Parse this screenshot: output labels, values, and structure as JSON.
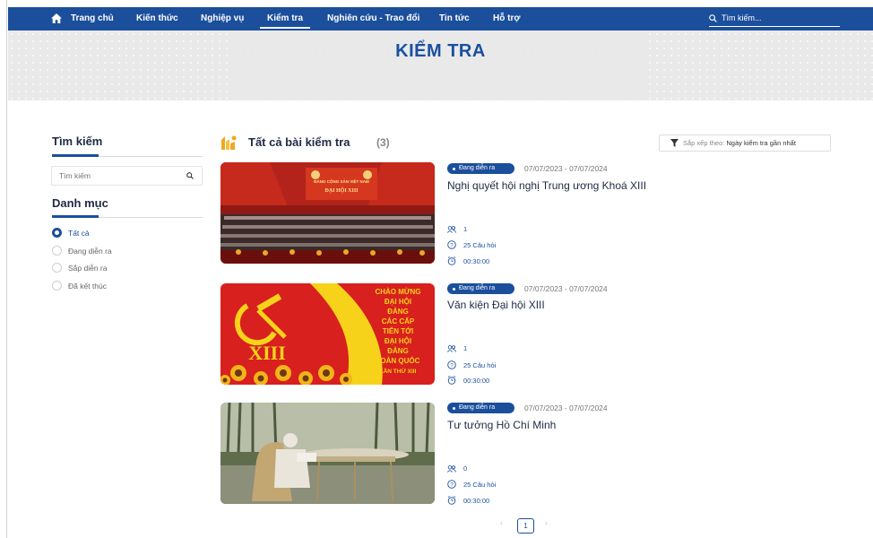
{
  "nav": {
    "items": [
      {
        "label": "Trang chủ"
      },
      {
        "label": "Kiến thức"
      },
      {
        "label": "Nghiệp vụ"
      },
      {
        "label": "Kiểm tra"
      },
      {
        "label": "Nghiên cứu - Trao đổi"
      },
      {
        "label": "Tin tức"
      },
      {
        "label": "Hỗ trợ"
      }
    ],
    "active_index": 3,
    "search_placeholder": "Tìm kiếm..."
  },
  "hero": {
    "title": "KIỂM TRA"
  },
  "sidebar": {
    "search_heading": "Tìm kiếm",
    "search_placeholder": "Tìm kiếm",
    "category_heading": "Danh mục",
    "categories": [
      {
        "label": "Tất cả",
        "checked": true
      },
      {
        "label": "Đang diễn ra",
        "checked": false
      },
      {
        "label": "Sắp diễn ra",
        "checked": false
      },
      {
        "label": "Đã kết thúc",
        "checked": false
      }
    ]
  },
  "list": {
    "title": "Tất cả bài kiểm tra",
    "count": "(3)",
    "sort_label": "Sắp xếp theo:",
    "sort_value": "Ngày kiểm tra gần nhất"
  },
  "cards": [
    {
      "status": "Đang diễn ra",
      "date_range": "07/07/2023 - 07/07/2024",
      "title": "Nghị quyết hội nghị Trung ương Khoá XIII",
      "participants": "1",
      "questions": "25 Câu hỏi",
      "duration": "00:30:00"
    },
    {
      "status": "Đang diễn ra",
      "date_range": "07/07/2023 - 07/07/2024",
      "title": "Văn kiện Đại hội XIII",
      "participants": "1",
      "questions": "25 Câu hỏi",
      "duration": "00:30:00"
    },
    {
      "status": "Đang diễn ra",
      "date_range": "07/07/2023 - 07/07/2024",
      "title": "Tư tưởng Hồ Chí Minh",
      "participants": "0",
      "questions": "25 Câu hỏi",
      "duration": "00:30:00"
    }
  ],
  "poster": {
    "banner_line1": "ĐẢNG CỘNG SẢN VIỆT NAM",
    "banner_line2": "ĐẠI HỘI XIII",
    "numeral": "XIII",
    "text_lines": [
      "CHÀO MỪNG",
      "ĐẠI HỘI",
      "ĐẢNG",
      "CÁC CẤP",
      "TIẾN TỚI",
      "ĐẠI HỘI",
      "ĐẢNG",
      "TOÀN QUỐC",
      "LẦN THỨ XIII"
    ]
  },
  "pagination": {
    "prev": "‹",
    "current": "1",
    "next": "›"
  },
  "colors": {
    "brand": "#1b4f9c",
    "poster_red": "#d8201f",
    "poster_yellow": "#f7d21a"
  }
}
